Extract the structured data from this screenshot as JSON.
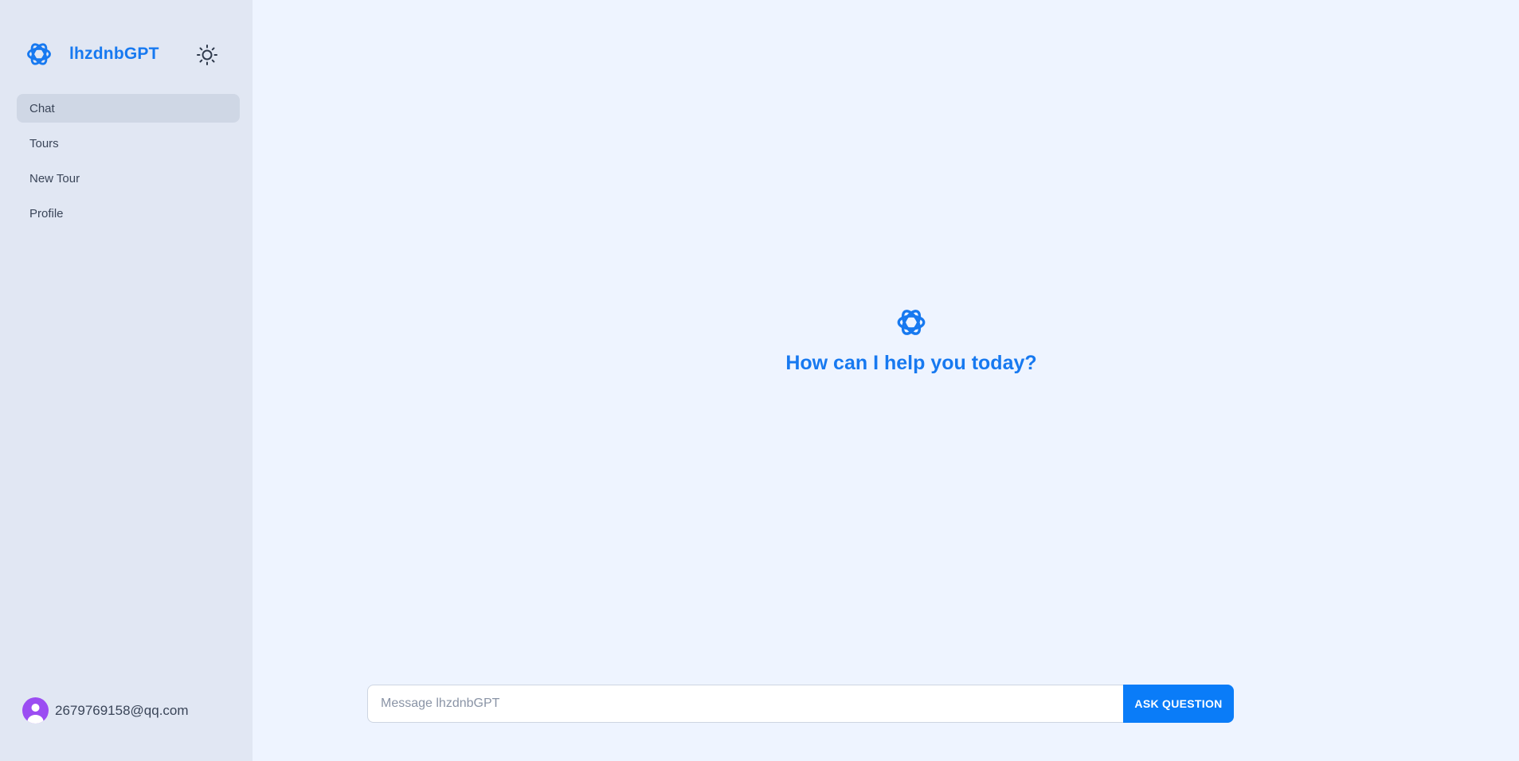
{
  "brand": {
    "name": "lhzdnbGPT",
    "color": "#1779f0"
  },
  "sidebar": {
    "items": [
      {
        "label": "Chat",
        "active": true
      },
      {
        "label": "Tours",
        "active": false
      },
      {
        "label": "New Tour",
        "active": false
      },
      {
        "label": "Profile",
        "active": false
      }
    ],
    "theme_toggle_icon": "sun-icon",
    "user": {
      "email": "2679769158@qq.com",
      "avatar_color": "#9b4df2"
    }
  },
  "main": {
    "welcome_title": "How can I help you today?",
    "composer": {
      "placeholder": "Message lhzdnbGPT",
      "value": "",
      "button_label": "ASK QUESTION",
      "button_color": "#0a7cf8"
    }
  }
}
